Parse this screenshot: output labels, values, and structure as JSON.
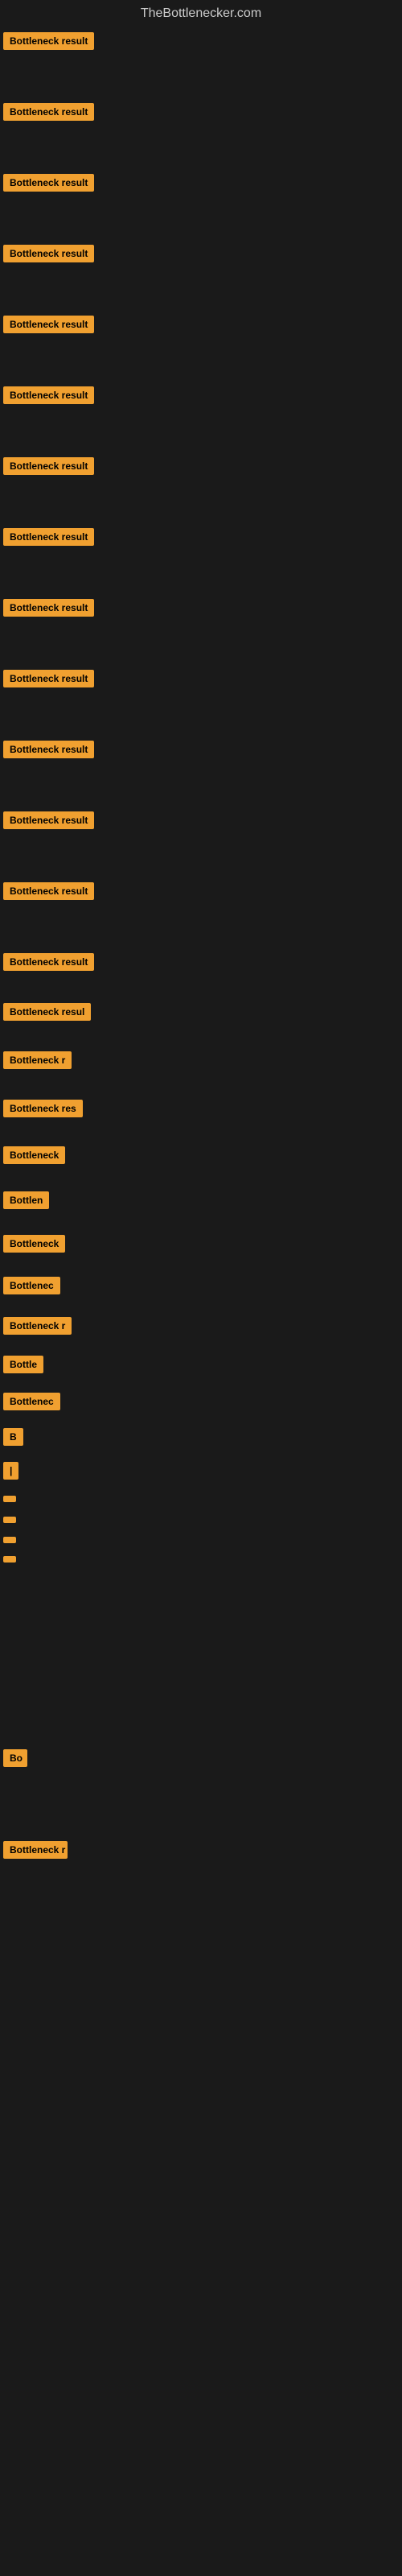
{
  "site": {
    "title": "TheBottlenecker.com"
  },
  "rows": [
    {
      "id": 0,
      "label": "Bottleneck result",
      "row_class": "row-0"
    },
    {
      "id": 1,
      "label": "Bottleneck result",
      "row_class": "row-1"
    },
    {
      "id": 2,
      "label": "Bottleneck result",
      "row_class": "row-2"
    },
    {
      "id": 3,
      "label": "Bottleneck result",
      "row_class": "row-3"
    },
    {
      "id": 4,
      "label": "Bottleneck result",
      "row_class": "row-4"
    },
    {
      "id": 5,
      "label": "Bottleneck result",
      "row_class": "row-5"
    },
    {
      "id": 6,
      "label": "Bottleneck result",
      "row_class": "row-6"
    },
    {
      "id": 7,
      "label": "Bottleneck result",
      "row_class": "row-7"
    },
    {
      "id": 8,
      "label": "Bottleneck result",
      "row_class": "row-8"
    },
    {
      "id": 9,
      "label": "Bottleneck result",
      "row_class": "row-9"
    },
    {
      "id": 10,
      "label": "Bottleneck result",
      "row_class": "row-10"
    },
    {
      "id": 11,
      "label": "Bottleneck result",
      "row_class": "row-11"
    },
    {
      "id": 12,
      "label": "Bottleneck result",
      "row_class": "row-12"
    },
    {
      "id": 13,
      "label": "Bottleneck result",
      "row_class": "row-13"
    },
    {
      "id": 14,
      "label": "Bottleneck resul",
      "row_class": "row-14"
    },
    {
      "id": 15,
      "label": "Bottleneck r",
      "row_class": "row-15"
    },
    {
      "id": 16,
      "label": "Bottleneck res",
      "row_class": "row-16"
    },
    {
      "id": 17,
      "label": "Bottleneck",
      "row_class": "row-17"
    },
    {
      "id": 18,
      "label": "Bottlen",
      "row_class": "row-18"
    },
    {
      "id": 19,
      "label": "Bottleneck",
      "row_class": "row-19"
    },
    {
      "id": 20,
      "label": "Bottlenec",
      "row_class": "row-20"
    },
    {
      "id": 21,
      "label": "Bottleneck r",
      "row_class": "row-21"
    },
    {
      "id": 22,
      "label": "Bottle",
      "row_class": "row-22"
    },
    {
      "id": 23,
      "label": "Bottlenec",
      "row_class": "row-23"
    },
    {
      "id": 24,
      "label": "B",
      "row_class": "row-24"
    },
    {
      "id": 25,
      "label": "|",
      "row_class": "row-25"
    },
    {
      "id": 26,
      "label": "",
      "row_class": "row-26"
    },
    {
      "id": 27,
      "label": "",
      "row_class": "row-27"
    },
    {
      "id": 28,
      "label": "",
      "row_class": "row-28"
    },
    {
      "id": 29,
      "label": "",
      "row_class": "row-29"
    },
    {
      "id": 30,
      "label": "Bo",
      "row_class": "row-32"
    },
    {
      "id": 31,
      "label": "Bottleneck r",
      "row_class": "row-33"
    }
  ]
}
